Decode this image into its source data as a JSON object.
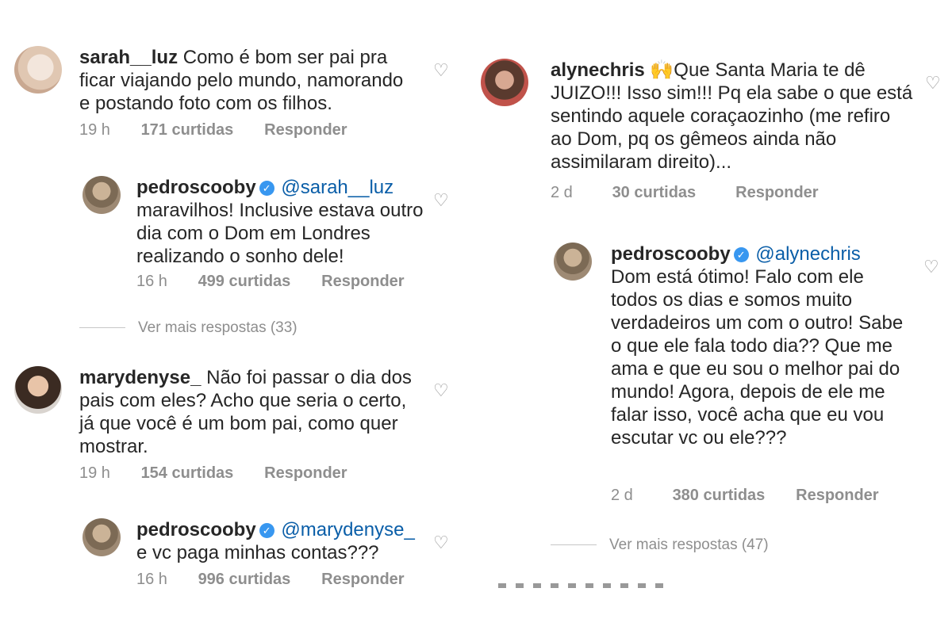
{
  "left": {
    "c1": {
      "username": "sarah__luz",
      "text": "Como é bom ser pai pra ficar viajando pelo mundo, namorando e postando foto com os filhos.",
      "time": "19 h",
      "likes": "171 curtidas",
      "reply": "Responder"
    },
    "r1": {
      "username": "pedroscooby",
      "mention": "@sarah__luz",
      "text": "maravilhos! Inclusive estava outro dia com o Dom em Londres realizando o sonho dele!",
      "time": "16 h",
      "likes": "499 curtidas",
      "reply": "Responder"
    },
    "more1": "Ver mais respostas (33)",
    "c2": {
      "username": "marydenyse_",
      "text": "Não foi passar o dia dos pais com eles?  Acho que seria o certo, já que você é um bom pai, como quer mostrar.",
      "time": "19 h",
      "likes": "154 curtidas",
      "reply": "Responder"
    },
    "r2": {
      "username": "pedroscooby",
      "mention": "@marydenyse_",
      "text": "e vc paga minhas contas???",
      "time": "16 h",
      "likes": "996 curtidas",
      "reply": "Responder"
    }
  },
  "right": {
    "c1": {
      "username": "alynechris",
      "emoji": "🙌",
      "text": "Que Santa Maria te dê JUIZO!!! Isso sim!!! Pq ela sabe o que está sentindo aquele coraçaozinho (me refiro ao Dom, pq os gêmeos ainda não assimilaram direito)...",
      "time": "2 d",
      "likes": "30 curtidas",
      "reply": "Responder"
    },
    "r1": {
      "username": "pedroscooby",
      "mention": "@alynechris",
      "text": "Dom está ótimo! Falo com ele todos os dias e somos muito verdadeiros um com o outro! Sabe o que ele fala todo dia?? Que me ama e que eu sou o melhor pai do mundo! Agora, depois de ele me falar isso, você acha que eu vou escutar vc ou ele???",
      "time": "2 d",
      "likes": "380 curtidas",
      "reply": "Responder"
    },
    "more1": "Ver mais respostas (47)"
  },
  "icons": {
    "heart": "heart-outline-icon",
    "verified": "verified-badge-icon"
  },
  "colors": {
    "text": "#262626",
    "meta": "#8e8e8e",
    "verified": "#3897f0",
    "mention": "#0a5ea8"
  }
}
